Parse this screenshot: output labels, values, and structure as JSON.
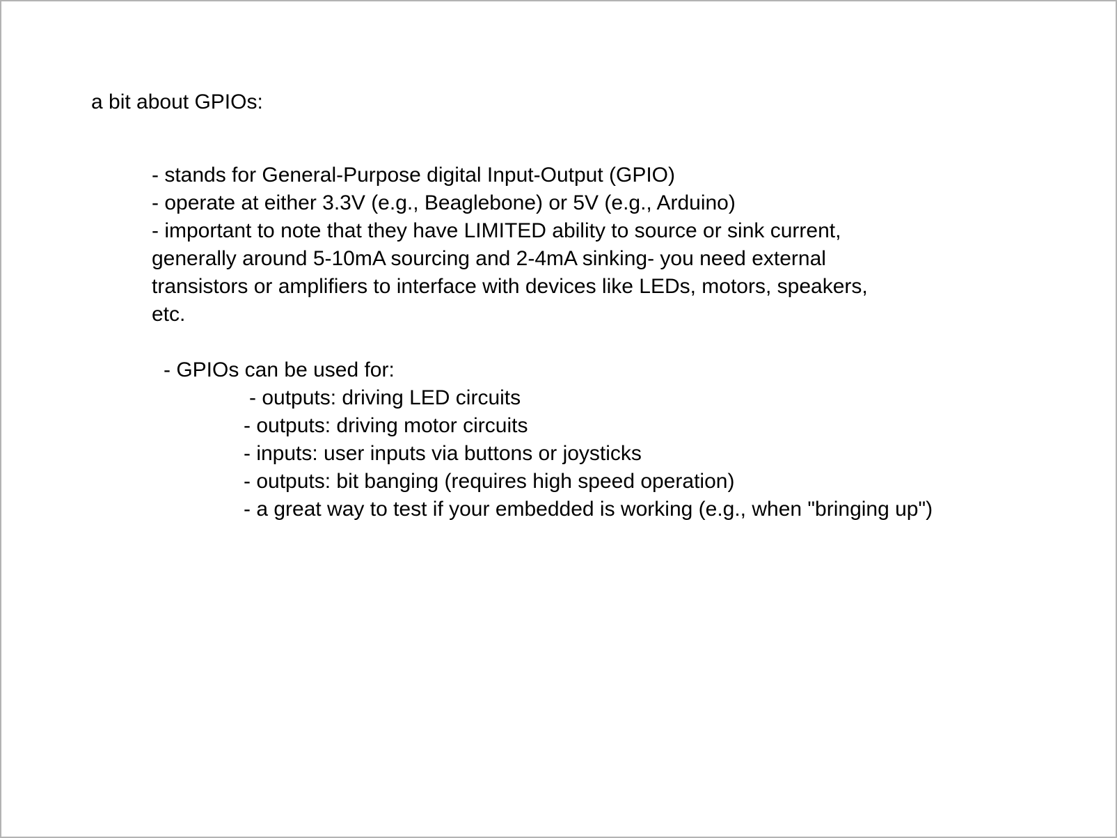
{
  "doc": {
    "title": "a bit about GPIOs:",
    "points": [
      "- stands for General-Purpose digital Input-Output (GPIO)",
      "- operate at either 3.3V (e.g., Beaglebone) or 5V (e.g., Arduino)"
    ],
    "limited_lines": [
      "- important to note that they have LIMITED ability to source or sink current,",
      "generally around 5-10mA sourcing and 2-4mA sinking- you need external",
      "transistors or amplifiers to interface with devices like LEDs, motors, speakers,",
      "etc."
    ],
    "uses_heading": "- GPIOs can be used for:",
    "uses": [
      "- outputs: driving LED circuits",
      "- outputs: driving motor circuits",
      "- inputs: user inputs via buttons or joysticks",
      "- outputs: bit banging (requires high speed operation)",
      "- a great way to test if your embedded is working (e.g., when \"bringing up\")"
    ]
  }
}
